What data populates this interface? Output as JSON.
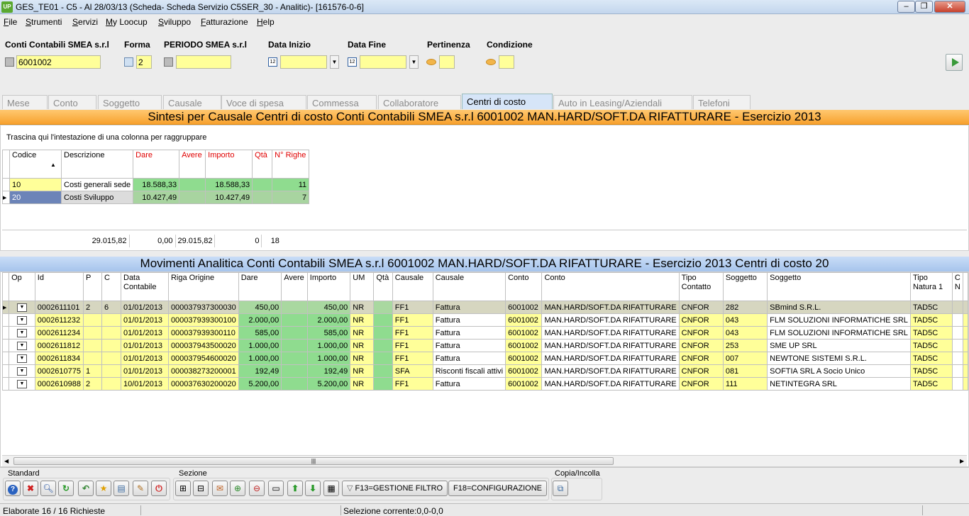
{
  "window": {
    "title": "GES_TE01 - C5 - Al 28/03/13 (Scheda- Scheda Servizio C5SER_30 - Analitic)- [161576-0-6]",
    "icon_text": "UP"
  },
  "menu": [
    "File",
    "Strumenti",
    "Servizi",
    "My Loocup",
    "Sviluppo",
    "Fatturazione",
    "Help"
  ],
  "filters": {
    "conti_label": "Conti Contabili SMEA s.r.l",
    "conti_value": "6001002",
    "forma_label": "Forma",
    "forma_value": "2",
    "periodo_label": "PERIODO SMEA s.r.l",
    "periodo_value": "",
    "data_inizio_label": "Data Inizio",
    "data_inizio_value": "",
    "data_fine_label": "Data Fine",
    "data_fine_value": "",
    "pertinenza_label": "Pertinenza",
    "pertinenza_value": "",
    "condizione_label": "Condizione",
    "condizione_value": ""
  },
  "tabs": [
    "Mese",
    "Conto",
    "Soggetto",
    "Causale",
    "Voce di spesa",
    "Commessa",
    "Collaboratore",
    "Centri di costo",
    "Auto in Leasing/Aziendali",
    "Telefoni"
  ],
  "active_tab": "Centri di costo",
  "summary": {
    "title": "Sintesi per Causale Centri di costo Conti Contabili SMEA s.r.l 6001002 MAN.HARD/SOFT.DA RIFATTURARE - Esercizio 2013",
    "group_hint": "Trascina qui l'intestazione di una colonna per raggruppare",
    "headers": [
      "Codice",
      "Descrizione",
      "Dare",
      "Avere",
      "Importo",
      "Qtà",
      "N° Righe"
    ],
    "rows": [
      {
        "codice": "10",
        "descrizione": "Costi generali sede",
        "dare": "18.588,33",
        "avere": "",
        "importo": "18.588,33",
        "qta": "",
        "righe": "11"
      },
      {
        "codice": "20",
        "descrizione": "Costi Sviluppo",
        "dare": "10.427,49",
        "avere": "",
        "importo": "10.427,49",
        "qta": "",
        "righe": "7"
      }
    ],
    "totals": {
      "dare": "29.015,82",
      "avere": "0,00",
      "importo": "29.015,82",
      "qta": "0",
      "righe": "18"
    }
  },
  "movements": {
    "title": "Movimenti Analitica Conti Contabili SMEA s.r.l 6001002 MAN.HARD/SOFT.DA RIFATTURARE - Esercizio 2013 Centri di costo 20",
    "headers": [
      "Op",
      "Id",
      "P",
      "C",
      "Data Contabile",
      "Riga Origine",
      "Dare",
      "Avere",
      "Importo",
      "UM",
      "Qtà",
      "Causale",
      "Causale",
      "Conto",
      "Conto",
      "Tipo Contatto",
      "Soggetto",
      "Soggetto",
      "Tipo Natura 1",
      "C N"
    ],
    "rows": [
      [
        "",
        "0002611101",
        "2",
        "6",
        "01/01/2013",
        "000037937300030",
        "450,00",
        "",
        "450,00",
        "NR",
        "",
        "FF1",
        "Fattura",
        "6001002",
        "MAN.HARD/SOFT.DA RIFATTURARE",
        "CNFOR",
        "282",
        "SBmind S.R.L.",
        "TAD5C",
        ""
      ],
      [
        "",
        "0002611232",
        "",
        "",
        "01/01/2013",
        "000037939300100",
        "2.000,00",
        "",
        "2.000,00",
        "NR",
        "",
        "FF1",
        "Fattura",
        "6001002",
        "MAN.HARD/SOFT.DA RIFATTURARE",
        "CNFOR",
        "043",
        "FLM SOLUZIONI INFORMATICHE SRL",
        "TAD5C",
        ""
      ],
      [
        "",
        "0002611234",
        "",
        "",
        "01/01/2013",
        "000037939300110",
        "585,00",
        "",
        "585,00",
        "NR",
        "",
        "FF1",
        "Fattura",
        "6001002",
        "MAN.HARD/SOFT.DA RIFATTURARE",
        "CNFOR",
        "043",
        "FLM SOLUZIONI INFORMATICHE SRL",
        "TAD5C",
        ""
      ],
      [
        "",
        "0002611812",
        "",
        "",
        "01/01/2013",
        "000037943500020",
        "1.000,00",
        "",
        "1.000,00",
        "NR",
        "",
        "FF1",
        "Fattura",
        "6001002",
        "MAN.HARD/SOFT.DA RIFATTURARE",
        "CNFOR",
        "253",
        "SME UP SRL",
        "TAD5C",
        ""
      ],
      [
        "",
        "0002611834",
        "",
        "",
        "01/01/2013",
        "000037954600020",
        "1.000,00",
        "",
        "1.000,00",
        "NR",
        "",
        "FF1",
        "Fattura",
        "6001002",
        "MAN.HARD/SOFT.DA RIFATTURARE",
        "CNFOR",
        "007",
        "NEWTONE SISTEMI S.R.L.",
        "TAD5C",
        ""
      ],
      [
        "",
        "0002610775",
        "1",
        "",
        "01/01/2013",
        "000038273200001",
        "192,49",
        "",
        "192,49",
        "NR",
        "",
        "SFA",
        "Risconti fiscali attivi",
        "6001002",
        "MAN.HARD/SOFT.DA RIFATTURARE",
        "CNFOR",
        "081",
        "SOFTIA SRL A Socio Unico",
        "TAD5C",
        ""
      ],
      [
        "",
        "0002610988",
        "2",
        "",
        "10/01/2013",
        "000037630200020",
        "5.200,00",
        "",
        "5.200,00",
        "NR",
        "",
        "FF1",
        "Fattura",
        "6001002",
        "MAN.HARD/SOFT.DA RIFATTURARE",
        "CNFOR",
        "111",
        "NETINTEGRA SRL",
        "TAD5C",
        ""
      ]
    ]
  },
  "toolbar": {
    "standard_label": "Standard",
    "sezione_label": "Sezione",
    "copia_label": "Copia/Incolla",
    "filtro_label": "F13=GESTIONE FILTRO",
    "config_label": "F18=CONFIGURAZIONE"
  },
  "status": {
    "left": "Elaborate 16 / 16 Richieste",
    "right": "Selezione corrente:0,0-0,0"
  },
  "colors": {
    "yellow": "#ffff99",
    "green": "#8fdc8f",
    "orange": "#f7a12e",
    "blue": "#a6c4ec"
  }
}
